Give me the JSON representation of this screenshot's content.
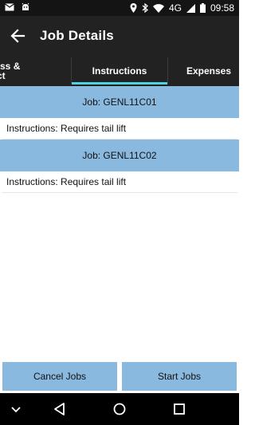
{
  "status_bar": {
    "left_icons": [
      "mail-icon",
      "android-icon"
    ],
    "right_icons": [
      "location-icon",
      "bluetooth-icon",
      "wifi-icon"
    ],
    "network": "4G",
    "time": "09:58"
  },
  "app_bar": {
    "title": "Job Details",
    "back_icon": "arrow-back-icon"
  },
  "tabs": [
    {
      "label_line1": "ldress &",
      "label_line2": "ntact"
    },
    {
      "label": "Instructions"
    },
    {
      "label": "Expenses"
    }
  ],
  "jobs": [
    {
      "title": "Job: GENL11C01",
      "instructions": "Instructions: Requires tail lift"
    },
    {
      "title": "Job: GENL11C02",
      "instructions": "Instructions: Requires tail lift"
    }
  ],
  "buttons": {
    "cancel_label": "Cancel Jobs",
    "start_label": "Start Jobs"
  },
  "colors": {
    "accent": "#8ab9e0",
    "tab_indicator": "#4fd3e3",
    "toolbar": "#222222"
  }
}
